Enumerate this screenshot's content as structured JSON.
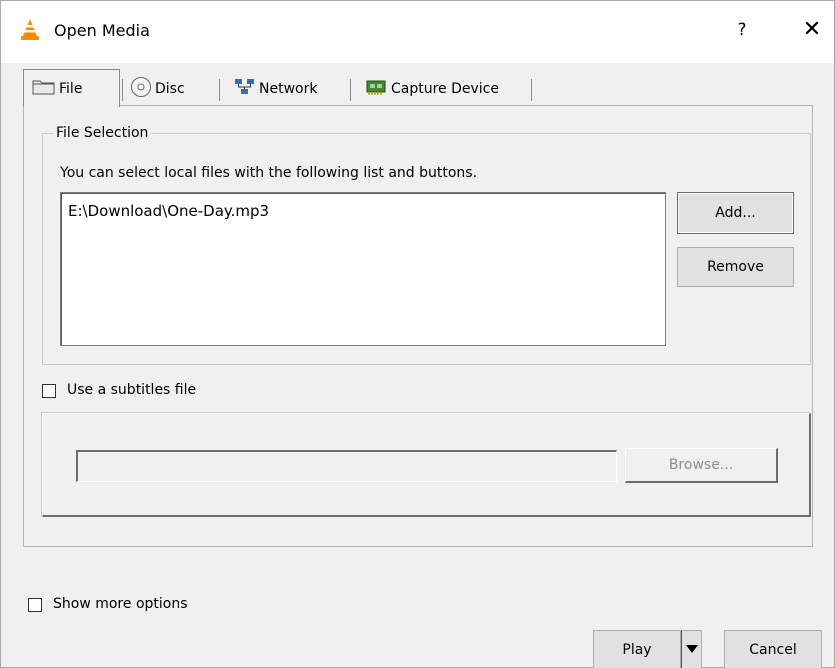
{
  "window": {
    "title": "Open Media",
    "help_label": "?",
    "close_label": "✕"
  },
  "tabs": [
    {
      "label": "File",
      "icon": "folder-icon",
      "active": true
    },
    {
      "label": "Disc",
      "icon": "disc-icon",
      "active": false
    },
    {
      "label": "Network",
      "icon": "network-icon",
      "active": false
    },
    {
      "label": "Capture Device",
      "icon": "capture-card-icon",
      "active": false
    }
  ],
  "file_selection": {
    "title": "File Selection",
    "description": "You can select local files with the following list and buttons.",
    "files": [
      "E:\\Download\\One-Day.mp3"
    ],
    "add_label": "Add...",
    "remove_label": "Remove"
  },
  "subtitles": {
    "checkbox_label": "Use a subtitles file",
    "checked": false,
    "path_value": "",
    "browse_label": "Browse..."
  },
  "footer": {
    "show_more_label": "Show more options",
    "show_more_checked": false,
    "play_label": "Play",
    "cancel_label": "Cancel"
  },
  "colors": {
    "window_bg": "#f0f0f0",
    "titlebar_bg": "#ffffff",
    "button_bg": "#e1e1e1",
    "vlc_orange": "#f28c00"
  }
}
